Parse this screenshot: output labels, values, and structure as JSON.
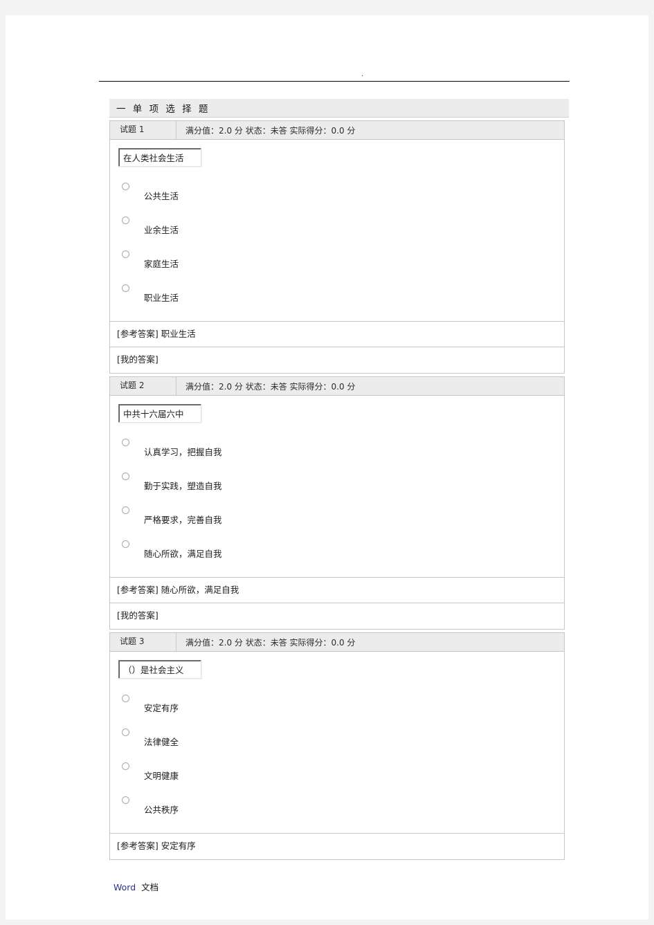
{
  "page": {
    "top_mark": ".",
    "footer": {
      "word_label": "Word",
      "doc_label": "文档"
    }
  },
  "section": {
    "title": "一 单 项 选 择 题"
  },
  "questions": [
    {
      "number_label": "试题 1",
      "meta_label": "满分值：2.0 分   状态：未答   实际得分：0.0 分",
      "max_score": "2.0",
      "status": "未答",
      "actual_score": "0.0",
      "stem": "在人类社会生活",
      "options": [
        {
          "label": "公共生活"
        },
        {
          "label": "业余生活"
        },
        {
          "label": "家庭生活"
        },
        {
          "label": "职业生活"
        }
      ],
      "reference_answer_tag": "[参考答案]",
      "reference_answer_value": "职业生活",
      "my_answer_tag": "[我的答案]",
      "my_answer_value": ""
    },
    {
      "number_label": "试题 2",
      "meta_label": "满分值：2.0 分   状态：未答   实际得分：0.0 分",
      "max_score": "2.0",
      "status": "未答",
      "actual_score": "0.0",
      "stem": "中共十六届六中",
      "options": [
        {
          "label": "认真学习，把握自我"
        },
        {
          "label": "勤于实践，塑造自我"
        },
        {
          "label": "严格要求，完善自我"
        },
        {
          "label": "随心所欲，满足自我"
        }
      ],
      "reference_answer_tag": "[参考答案]",
      "reference_answer_value": "随心所欲，满足自我",
      "my_answer_tag": "[我的答案]",
      "my_answer_value": ""
    },
    {
      "number_label": "试题 3",
      "meta_label": "满分值：2.0 分   状态：未答   实际得分：0.0 分",
      "max_score": "2.0",
      "status": "未答",
      "actual_score": "0.0",
      "stem": "（）是社会主义",
      "options": [
        {
          "label": "安定有序"
        },
        {
          "label": "法律健全"
        },
        {
          "label": "文明健康"
        },
        {
          "label": "公共秩序"
        }
      ],
      "reference_answer_tag": "[参考答案]",
      "reference_answer_value": "安定有序",
      "my_answer_tag": null,
      "my_answer_value": null
    }
  ]
}
